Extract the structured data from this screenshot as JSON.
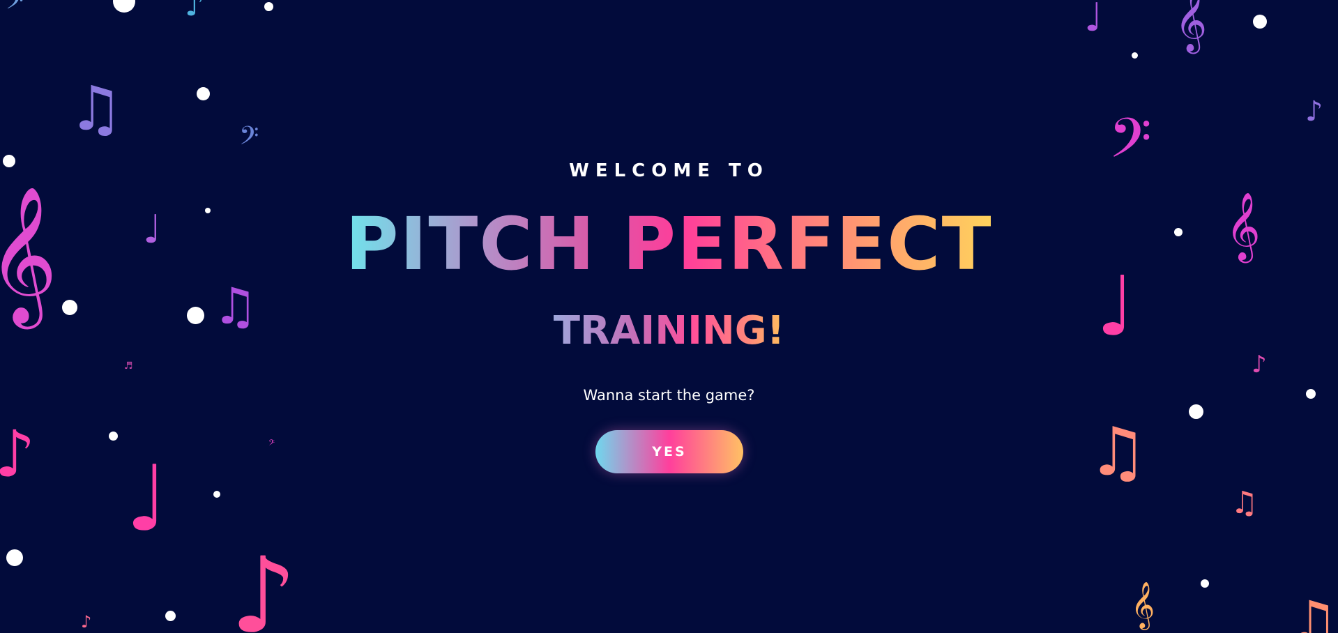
{
  "welcome": {
    "pre_title": "WELCOME TO",
    "title": "PITCH PERFECT",
    "subtitle": "TRAINING!",
    "question": "Wanna start the game?",
    "yes_button": "YES"
  },
  "colors": {
    "background": "#020b3b",
    "gradient": [
      "#6fe3ec",
      "#b58ec8",
      "#ff3d9a",
      "#ff9a70",
      "#ffd35c"
    ],
    "dots": "#ffffff"
  },
  "decorations": {
    "notes": [
      {
        "name": "bass-clef-icon",
        "glyph": "𝄢",
        "color": "#6fa0e0"
      },
      {
        "name": "eighth-note-icon",
        "glyph": "♪",
        "color": "#4fb3e0"
      },
      {
        "name": "beamed-notes-icon",
        "glyph": "♫",
        "color": "#8c7ae0"
      },
      {
        "name": "bass-clef-icon",
        "glyph": "𝄢",
        "color": "#6a84d8"
      },
      {
        "name": "quarter-note-icon",
        "glyph": "♩",
        "color": "#b060e0"
      },
      {
        "name": "treble-clef-icon",
        "glyph": "𝄞",
        "color": "#e04cd0"
      },
      {
        "name": "beamed-notes-icon",
        "glyph": "♫",
        "color": "#b050e0"
      },
      {
        "name": "beamed-notes-icon",
        "glyph": "♬",
        "color": "#d64cb0"
      },
      {
        "name": "bass-clef-icon",
        "glyph": "𝄢",
        "color": "#e040c0"
      },
      {
        "name": "eighth-note-icon",
        "glyph": "♪",
        "color": "#ff3fa6"
      },
      {
        "name": "quarter-note-icon",
        "glyph": "♩",
        "color": "#ff3fa6"
      },
      {
        "name": "eighth-note-icon",
        "glyph": "♪",
        "color": "#ff4f9a"
      },
      {
        "name": "eighth-note-icon",
        "glyph": "♪",
        "color": "#ff6a90"
      },
      {
        "name": "quarter-note-icon",
        "glyph": "♩",
        "color": "#b056e0"
      },
      {
        "name": "treble-clef-icon",
        "glyph": "𝄞",
        "color": "#a060e0"
      },
      {
        "name": "eighth-note-icon",
        "glyph": "♪",
        "color": "#9070e0"
      },
      {
        "name": "bass-clef-icon",
        "glyph": "𝄢",
        "color": "#e040d0"
      },
      {
        "name": "treble-clef-icon",
        "glyph": "𝄞",
        "color": "#e040d0"
      },
      {
        "name": "quarter-note-icon",
        "glyph": "♩",
        "color": "#ff3fa6"
      },
      {
        "name": "eighth-note-icon",
        "glyph": "♪",
        "color": "#e04cb0"
      },
      {
        "name": "beamed-notes-icon",
        "glyph": "♫",
        "color": "#ff8c7a"
      },
      {
        "name": "beamed-notes-icon",
        "glyph": "♫",
        "color": "#ff7a80"
      },
      {
        "name": "treble-clef-icon",
        "glyph": "𝄞",
        "color": "#ffb060"
      },
      {
        "name": "beamed-notes-icon",
        "glyph": "♫",
        "color": "#ff8f70"
      }
    ]
  }
}
